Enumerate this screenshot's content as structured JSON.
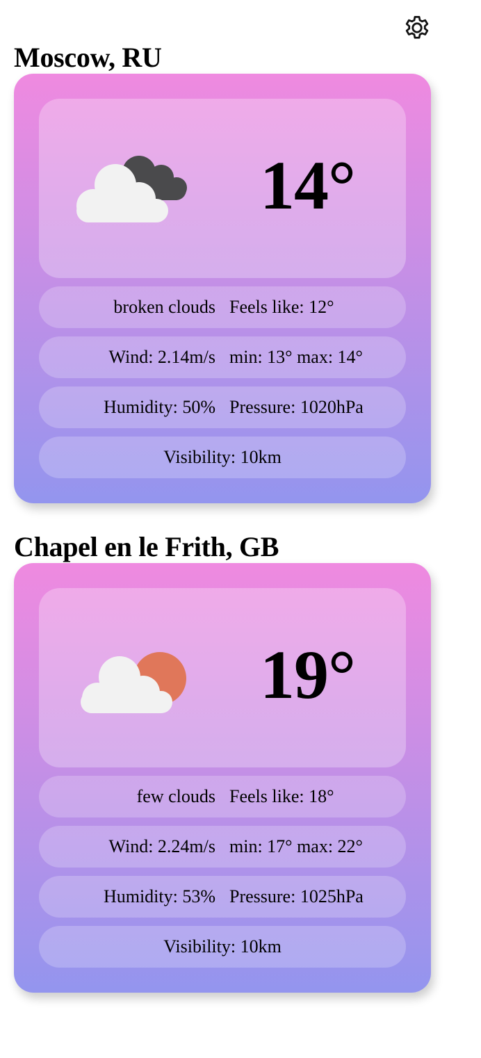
{
  "header": {
    "settings_icon": "gear-icon"
  },
  "cities": [
    {
      "name": "Moscow, RU",
      "icon": "broken-clouds-icon",
      "temperature": "14°",
      "description": "broken clouds",
      "feels_like": "Feels like: 12°",
      "wind": "Wind: 2.14m/s",
      "min_max": "min: 13° max: 14°",
      "humidity": "Humidity: 50%",
      "pressure": "Pressure: 1020hPa",
      "visibility": "Visibility: 10km"
    },
    {
      "name": "Chapel en le Frith, GB",
      "icon": "few-clouds-sun-icon",
      "temperature": "19°",
      "description": "few clouds",
      "feels_like": "Feels like: 18°",
      "wind": "Wind: 2.24m/s",
      "min_max": "min: 17° max: 22°",
      "humidity": "Humidity: 53%",
      "pressure": "Pressure: 1025hPa",
      "visibility": "Visibility: 10km"
    }
  ],
  "colors": {
    "card_gradient_top": "#ef8ae0",
    "card_gradient_mid": "#c48fe6",
    "card_gradient_bottom": "#9395ee",
    "cloud_white": "#f2f2f2",
    "cloud_dark": "#4a4a4c",
    "sun": "#e0775a"
  }
}
